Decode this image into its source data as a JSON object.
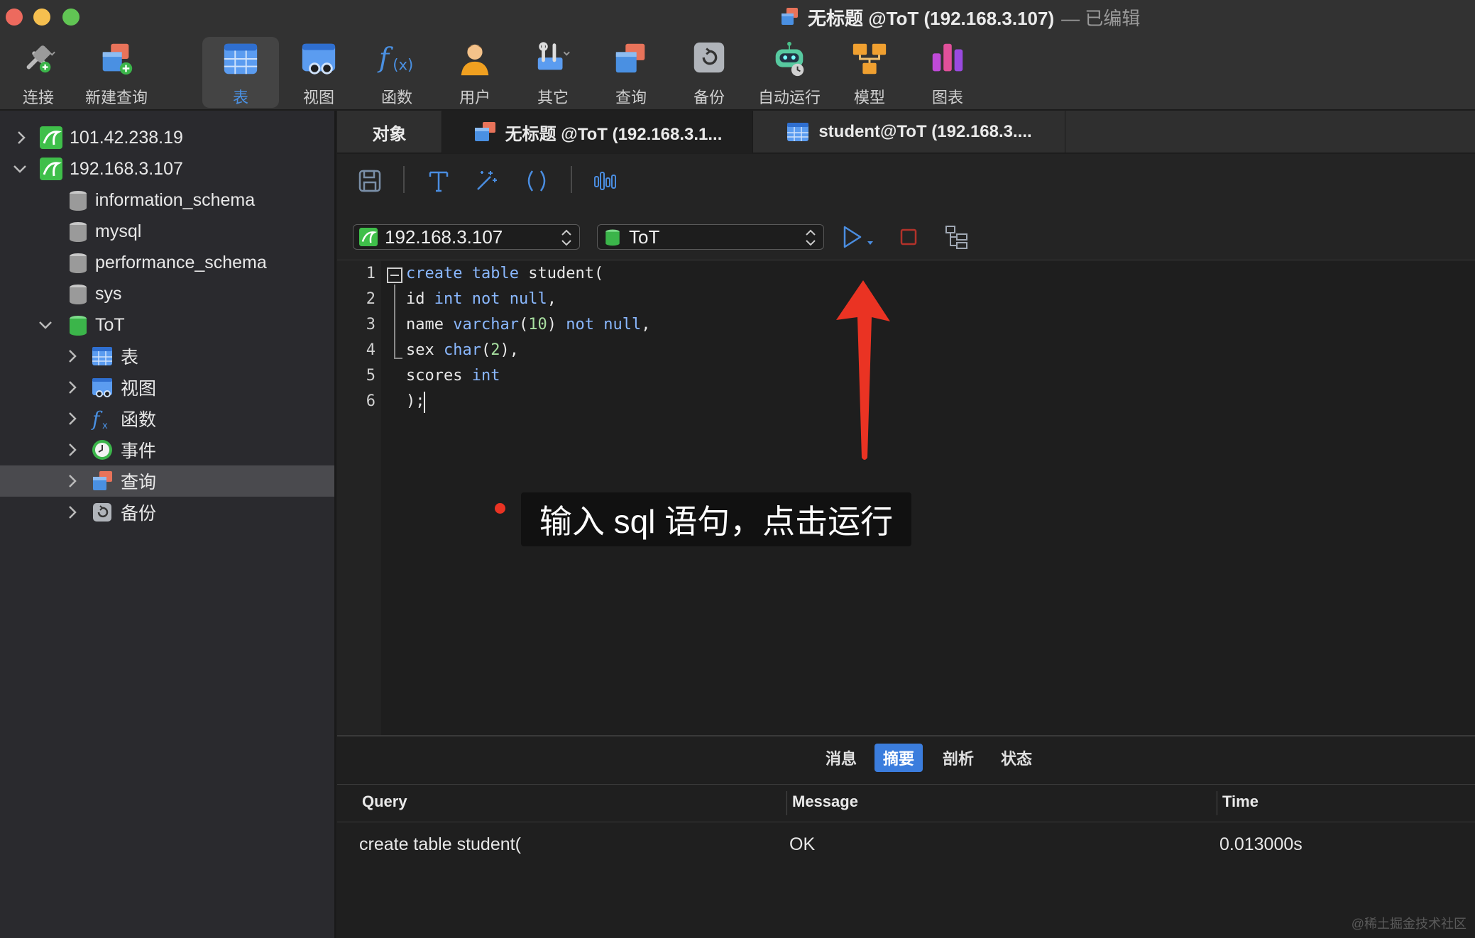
{
  "window": {
    "title": "无标题 @ToT (192.168.3.107)",
    "edited_suffix": "— 已编辑"
  },
  "toolbar": {
    "buttons": [
      {
        "label": "连接",
        "icon": "plug-icon"
      },
      {
        "label": "新建查询",
        "icon": "new-query-icon"
      },
      {
        "label": "表",
        "icon": "table-icon",
        "active": true
      },
      {
        "label": "视图",
        "icon": "view-icon"
      },
      {
        "label": "函数",
        "icon": "function-icon"
      },
      {
        "label": "用户",
        "icon": "user-icon"
      },
      {
        "label": "其它",
        "icon": "tools-icon"
      },
      {
        "label": "查询",
        "icon": "query-icon"
      },
      {
        "label": "备份",
        "icon": "backup-icon"
      },
      {
        "label": "自动运行",
        "icon": "robot-icon"
      },
      {
        "label": "模型",
        "icon": "model-icon"
      },
      {
        "label": "图表",
        "icon": "chart-icon"
      }
    ]
  },
  "sidebar": {
    "connections": [
      {
        "label": "101.42.238.19",
        "expanded": false
      },
      {
        "label": "192.168.3.107",
        "expanded": true
      }
    ],
    "databases": [
      "information_schema",
      "mysql",
      "performance_schema",
      "sys",
      "ToT"
    ],
    "tot_children": [
      "表",
      "视图",
      "函数",
      "事件",
      "查询",
      "备份"
    ],
    "selected": "查询"
  },
  "tabs": [
    {
      "label": "对象"
    },
    {
      "label": "无标题 @ToT (192.168.3.1..."
    },
    {
      "label": "student@ToT (192.168.3...."
    }
  ],
  "editor_toolbar": {
    "connection_select": "192.168.3.107",
    "database_select": "ToT"
  },
  "code": {
    "line_numbers": [
      "1",
      "2",
      "3",
      "4",
      "5",
      "6"
    ],
    "lines": [
      "create table student(",
      "id int not null,",
      "name varchar(10) not null,",
      "sex char(2),",
      "scores int",
      ");"
    ]
  },
  "annotation": {
    "text": "输入 sql 语句，点击运行",
    "color": "#ea3323"
  },
  "results": {
    "tabs": [
      "消息",
      "摘要",
      "剖析",
      "状态"
    ],
    "active_tab": "摘要",
    "columns": [
      "Query",
      "Message",
      "Time"
    ],
    "rows": [
      [
        "create table student(",
        "OK",
        "0.013000s"
      ]
    ]
  },
  "watermark": "@稀土掘金技术社区",
  "colors": {
    "accent": "#3b7ddd",
    "traffic_red": "#ed6a5e",
    "traffic_yellow": "#f5bf4f",
    "traffic_green": "#61c554"
  }
}
